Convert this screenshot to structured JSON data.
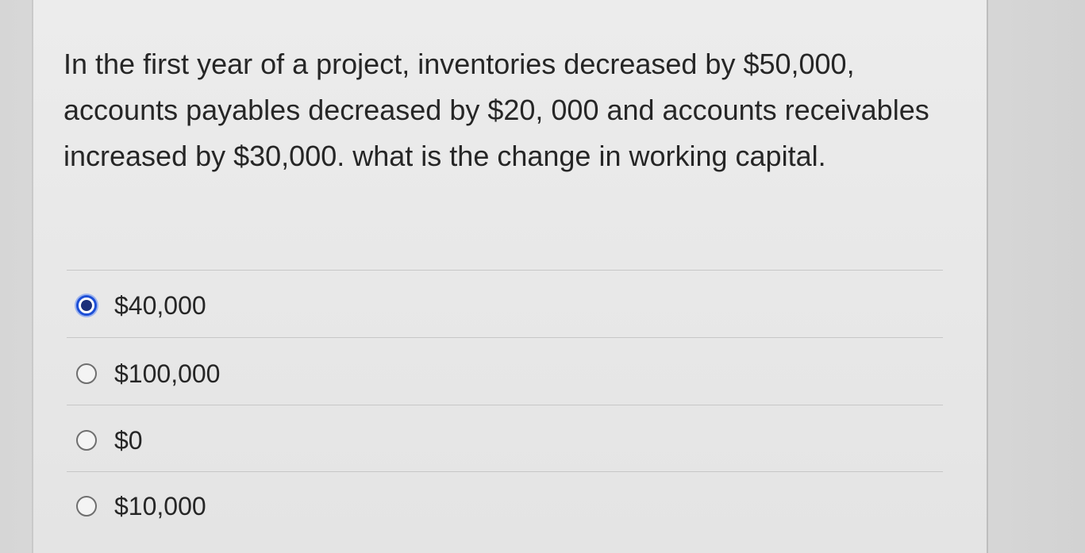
{
  "question": {
    "text": "In the first year of a project, inventories decreased by $50,000, accounts payables decreased by $20, 000 and accounts receivables increased by $30,000. what is the change in working capital."
  },
  "options": [
    {
      "label": "$40,000",
      "selected": true
    },
    {
      "label": "$100,000",
      "selected": false
    },
    {
      "label": "$0",
      "selected": false
    },
    {
      "label": "$10,000",
      "selected": false
    }
  ],
  "colors": {
    "selected_radio": "#1d4fd6",
    "text": "#262626"
  }
}
